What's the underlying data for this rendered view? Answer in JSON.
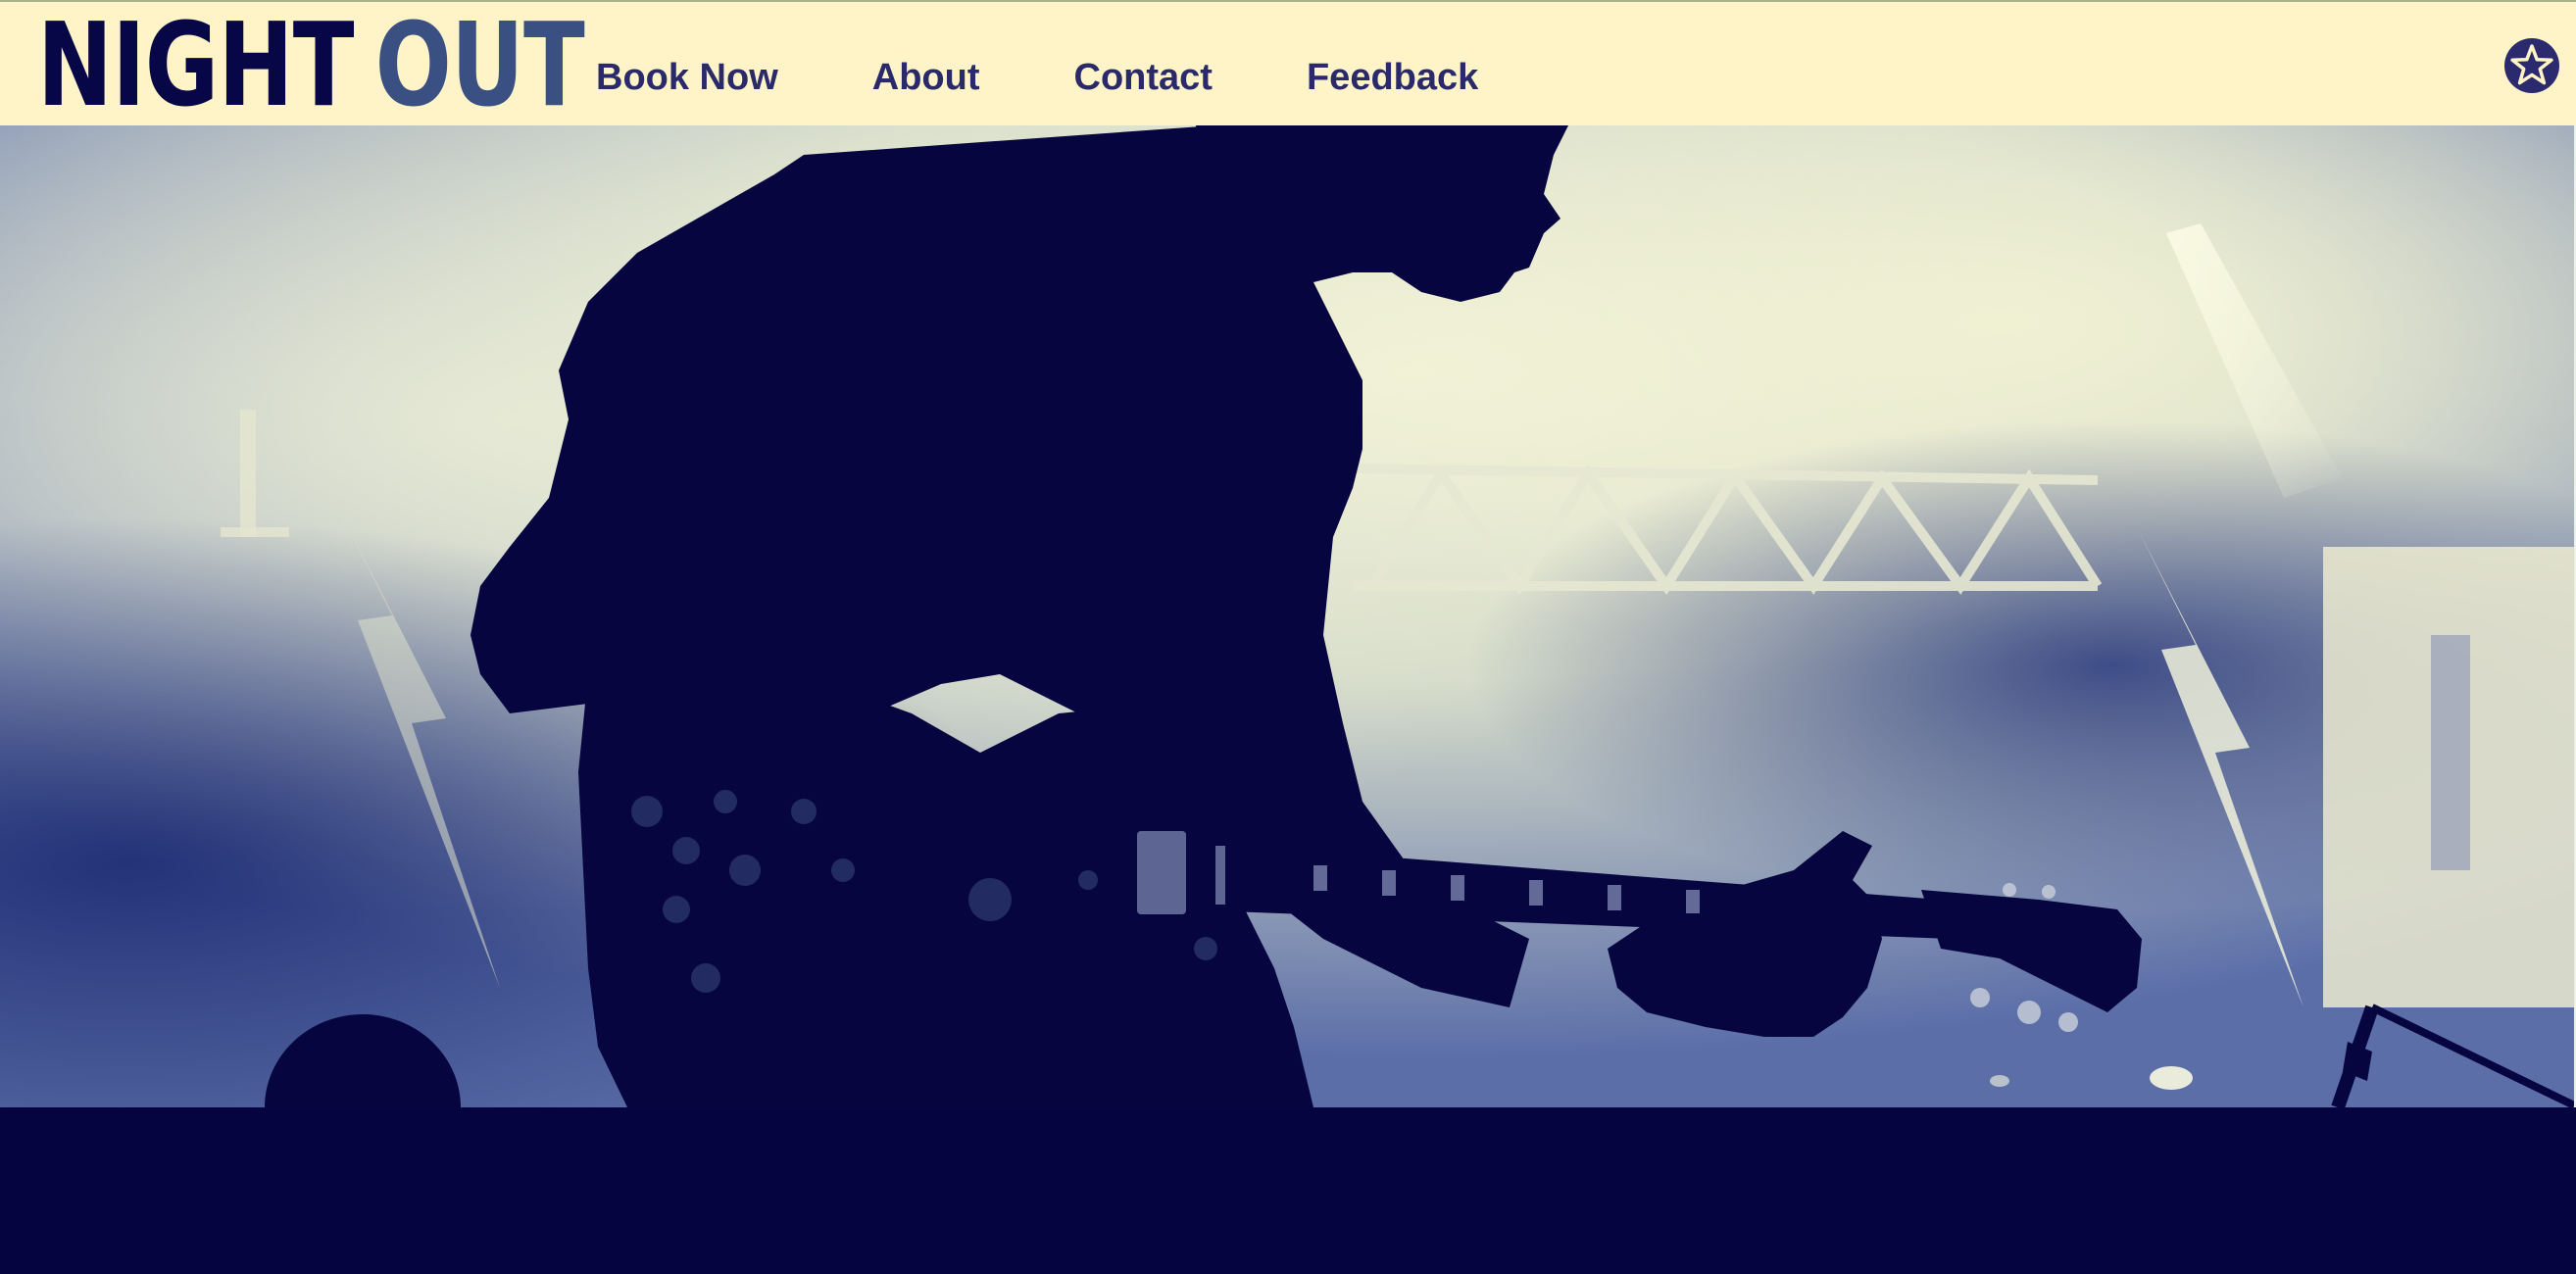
{
  "brand": {
    "word1": "NIGHT",
    "word2": "OUT"
  },
  "nav": {
    "items": [
      {
        "label": "Book Now"
      },
      {
        "label": "About"
      },
      {
        "label": "Contact"
      },
      {
        "label": "Feedback"
      }
    ]
  },
  "header": {
    "badge_icon": "star-icon"
  },
  "hero": {
    "image_description_icon": "concert-guitarist-photo"
  },
  "colors": {
    "header_bg": "#fff4c8",
    "brand_dark": "#070646",
    "brand_light": "#3a4f82",
    "nav_text": "#2a2a6a",
    "footer_bg": "#050440",
    "smoke": "#eef0d2",
    "stage_blue": "#2a3d86"
  }
}
